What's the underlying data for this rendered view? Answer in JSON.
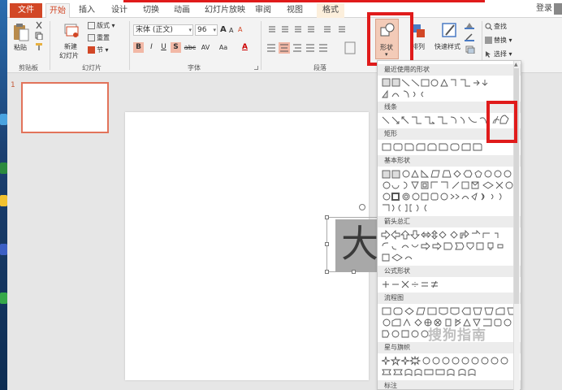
{
  "tabs": {
    "file": "文件",
    "home": "开始",
    "insert": "插入",
    "design": "设计",
    "transitions": "切换",
    "animations": "动画",
    "slideshow": "幻灯片放映",
    "review": "审阅",
    "view": "视图",
    "format": "格式",
    "login": "登录"
  },
  "ribbon": {
    "clipboard": {
      "paste": "粘贴",
      "label": "剪贴板"
    },
    "slides": {
      "new_slide": "新建",
      "new_slide_line2": "幻灯片",
      "layout": "版式",
      "reset": "重置",
      "section": "节",
      "label": "幻灯片"
    },
    "font": {
      "font_name": "宋体 (正文)",
      "font_size": "96",
      "bold": "B",
      "italic": "I",
      "underline": "U",
      "shadow": "S",
      "strike": "abc",
      "spacing": "AV",
      "case": "Aa",
      "color": "A",
      "grow": "A",
      "shrink": "A",
      "clear": "A",
      "label": "字体"
    },
    "paragraph": {
      "label": "段落"
    },
    "drawing": {
      "shapes": "形状",
      "arrange": "排列",
      "quick_styles": "快速样式"
    },
    "editing": {
      "find": "查找",
      "replace": "替换",
      "select": "选择"
    }
  },
  "slide_panel": {
    "number": "1"
  },
  "slide": {
    "text": "大"
  },
  "dropdown": {
    "sections": [
      "最近使用的形状",
      "线条",
      "矩形",
      "基本形状",
      "箭头总汇",
      "公式形状",
      "流程图",
      "星与旗帜",
      "标注"
    ]
  },
  "watermark": "搜狗指南",
  "colors": {
    "accent": "#d24726",
    "highlight": "#e01b1b"
  }
}
